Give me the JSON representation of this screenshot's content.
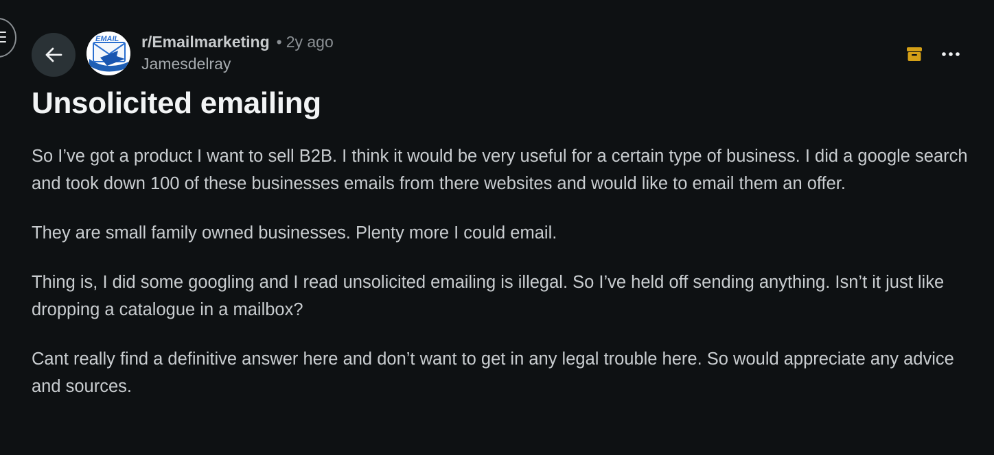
{
  "header": {
    "menu_icon": "hamburger-menu-icon",
    "back_icon": "arrow-left-icon",
    "avatar_icon": "email-envelope-icon",
    "avatar_text": "EMAIL",
    "subreddit": "r/Emailmarketing",
    "separator": "•",
    "timestamp": "2y ago",
    "username": "Jamesdelray",
    "archive_icon": "archive-box-icon",
    "more_icon": "more-horizontal-icon"
  },
  "post": {
    "title": "Unsolicited emailing",
    "paragraphs": [
      "So I’ve got a product I want to sell B2B. I think it would be very useful for a certain type of business. I did a google search and took down 100 of these businesses emails from there websites and would like to email them an offer.",
      "They are small family owned businesses. Plenty more I could email.",
      "Thing is, I did some googling and I read unsolicited emailing is illegal. So I’ve held off sending anything. Isn’t it just like dropping a catalogue in a mailbox?",
      "Cant really find a definitive answer here and don’t want to get in any legal trouble here. So would appreciate any advice and sources."
    ]
  },
  "colors": {
    "background": "#0e1113",
    "archive_accent": "#d4a017",
    "back_button_bg": "#2a3236"
  }
}
